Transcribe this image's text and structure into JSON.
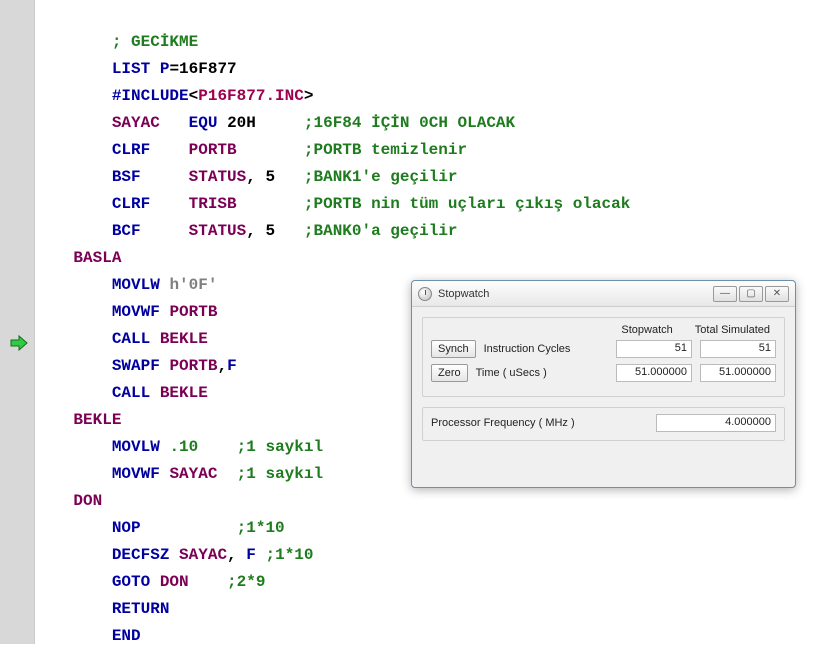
{
  "code": {
    "l1_cmt": "; GECİKME",
    "l2": {
      "kw1": "LIST",
      "kw2": "P",
      "eq": "=",
      "val": "16F877"
    },
    "l3": {
      "dir": "#INCLUDE",
      "lt": "<",
      "file": "P16F877.INC",
      "gt": ">"
    },
    "l4": {
      "a": "SAYAC",
      "b": "EQU",
      "c": "20H",
      "cmt": ";16F84 İÇİN 0CH OLACAK"
    },
    "l5": {
      "a": "CLRF",
      "b": "PORTB",
      "cmt": ";PORTB temizlenir"
    },
    "l6": {
      "a": "BSF",
      "b": "STATUS",
      "c": ",",
      "d": "5",
      "cmt": ";BANK1'e geçilir"
    },
    "l7": {
      "a": "CLRF",
      "b": "TRISB",
      "cmt": ";PORTB nin tüm uçları çıkış olacak"
    },
    "l8": {
      "a": "BCF",
      "b": "STATUS",
      "c": ",",
      "d": "5",
      "cmt": ";BANK0'a geçilir"
    },
    "l9": "BASLA",
    "l10": {
      "a": "MOVLW",
      "b": "h'0F'"
    },
    "l11": {
      "a": "MOVWF",
      "b": "PORTB"
    },
    "l12": {
      "a": "CALL",
      "b": "BEKLE"
    },
    "l13": {
      "a": "SWAPF",
      "b": "PORTB",
      "c": ",",
      "d": "F"
    },
    "l14": {
      "a": "CALL",
      "b": "BEKLE"
    },
    "l15": "BEKLE",
    "l16": {
      "a": "MOVLW",
      "b": ".10",
      "cmt": ";1 saykıl"
    },
    "l17": {
      "a": "MOVWF",
      "b": "SAYAC",
      "cmt": ";1 saykıl"
    },
    "l18": "DON",
    "l19": {
      "a": "NOP",
      "cmt": ";1*10"
    },
    "l20": {
      "a": "DECFSZ",
      "b": "SAYAC",
      "c": ",",
      "d": "F",
      "cmt": ";1*10"
    },
    "l21": {
      "a": "GOTO",
      "b": "DON",
      "cmt": ";2*9"
    },
    "l22": "RETURN",
    "l23": "END"
  },
  "stopwatch": {
    "title": "Stopwatch",
    "min_icon": "—",
    "max_icon": "▢",
    "close_icon": "✕",
    "hdr1": "Stopwatch",
    "hdr2": "Total Simulated",
    "synch": "Synch",
    "zero": "Zero",
    "row1_label": "Instruction Cycles",
    "row1_v1": "51",
    "row1_v2": "51",
    "row2_label": "Time   ( uSecs )",
    "row2_v1": "51.000000",
    "row2_v2": "51.000000",
    "row3_label": "Processor Frequency    ( MHz )",
    "row3_v1": "4.000000"
  }
}
